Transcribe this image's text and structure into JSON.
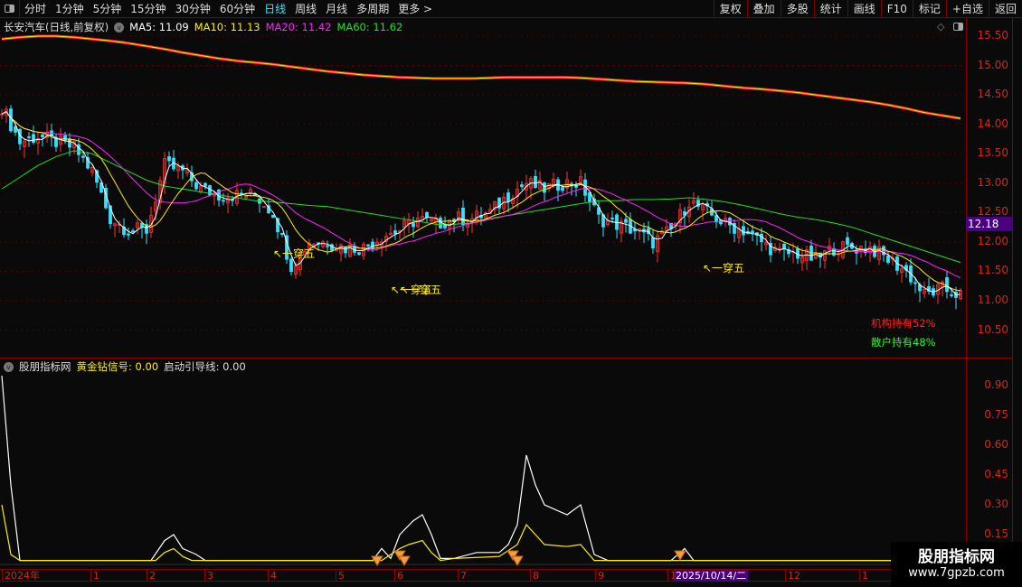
{
  "toolbar": {
    "periods": [
      "分时",
      "1分钟",
      "5分钟",
      "15分钟",
      "30分钟",
      "60分钟",
      "日线",
      "周线",
      "月线",
      "多周期",
      "更多 >"
    ],
    "active_period": "日线",
    "buttons": [
      "复权",
      "叠加",
      "多股",
      "统计",
      "画线",
      "F10",
      "标记",
      "+自选",
      "返回"
    ]
  },
  "main_legend": {
    "title": "长安汽车(日线,前复权)",
    "ma5": "MA5: 11.09",
    "ma10": "MA10: 11.13",
    "ma20": "MA20: 11.42",
    "ma60": "MA60: 11.62"
  },
  "price_axis": [
    "15.50",
    "15.00",
    "14.50",
    "14.00",
    "13.50",
    "13.00",
    "12.50",
    "12.00",
    "11.50",
    "11.00",
    "10.50"
  ],
  "current_price": "12.18",
  "annotation_label": "↖一穿五",
  "holdings": {
    "institution": "机构持有52%",
    "retail": "散户持有48%"
  },
  "sub_legend": {
    "title": "股朋指标网",
    "signal": "黄金钻信号: 0.00",
    "guide": "启动引导线: 0.00"
  },
  "sub_axis": [
    "0.90",
    "0.75",
    "0.60",
    "0.45",
    "0.30",
    "0.15"
  ],
  "x_axis": {
    "months": [
      "2024年",
      "1",
      "2",
      "3",
      "4",
      "5",
      "6",
      "7",
      "8",
      "9",
      "1",
      "12",
      "1"
    ],
    "cursor_date": "2025/10/14/二"
  },
  "watermark": {
    "name": "股朋指标网",
    "url": "www.7gpzb.com"
  },
  "colors": {
    "up": "#ff3030",
    "down": "#33e0ff",
    "ma5": "#ffffff",
    "ma10": "#ffee00",
    "ma20": "#ff20ff",
    "ma60": "#20e020",
    "accent": "#4a0080"
  },
  "chart_data": {
    "type": "candlestick",
    "price_range": [
      10.3,
      15.7
    ],
    "close_every_4_bars": [
      14.3,
      13.7,
      13.8,
      13.7,
      13.6,
      13.2,
      12.4,
      12.2,
      12.2,
      13.3,
      13.2,
      12.9,
      12.8,
      12.8,
      12.8,
      12.5,
      11.6,
      12.0,
      12.0,
      11.9,
      11.9,
      12.1,
      12.2,
      12.4,
      12.3,
      12.4,
      12.4,
      12.5,
      12.8,
      13.0,
      12.9,
      13.0,
      13.0,
      12.4,
      12.3,
      12.2,
      12.0,
      12.2,
      12.7,
      12.5,
      12.3,
      12.2,
      12.0,
      11.8,
      11.8,
      11.7,
      11.9,
      11.9,
      11.9,
      11.7,
      11.5,
      11.1,
      11.2,
      11.1
    ],
    "ma60_every_4_bars": [
      12.9,
      13.1,
      13.3,
      13.45,
      13.55,
      13.5,
      13.35,
      13.2,
      13.05,
      12.95,
      12.9,
      12.85,
      12.8,
      12.75,
      12.7,
      12.68,
      12.65,
      12.62,
      12.6,
      12.55,
      12.5,
      12.45,
      12.4,
      12.35,
      12.3,
      12.3,
      12.32,
      12.4,
      12.45,
      12.5,
      12.55,
      12.6,
      12.65,
      12.7,
      12.7,
      12.72,
      12.72,
      12.73,
      12.75,
      12.72,
      12.68,
      12.62,
      12.55,
      12.48,
      12.42,
      12.38,
      12.32,
      12.25,
      12.15,
      12.05,
      11.95,
      11.85,
      11.75,
      11.65
    ],
    "long_ma_every_4_bars": [
      15.45,
      15.48,
      15.5,
      15.5,
      15.48,
      15.45,
      15.42,
      15.38,
      15.33,
      15.28,
      15.22,
      15.17,
      15.12,
      15.08,
      15.05,
      15.02,
      14.98,
      14.94,
      14.9,
      14.87,
      14.84,
      14.82,
      14.8,
      14.79,
      14.78,
      14.78,
      14.78,
      14.79,
      14.8,
      14.8,
      14.8,
      14.8,
      14.79,
      14.77,
      14.75,
      14.73,
      14.72,
      14.71,
      14.7,
      14.68,
      14.65,
      14.62,
      14.6,
      14.57,
      14.54,
      14.5,
      14.46,
      14.42,
      14.38,
      14.33,
      14.27,
      14.2,
      14.15,
      14.1
    ],
    "annotations_bar": [
      61,
      87,
      89,
      156
    ],
    "indicator": {
      "name": "股朋指标网",
      "y_range": [
        0,
        1.0
      ],
      "white": [
        [
          0,
          0.95
        ],
        [
          2,
          0.4
        ],
        [
          4,
          0.02
        ],
        [
          33,
          0.02
        ],
        [
          36,
          0.12
        ],
        [
          38,
          0.15
        ],
        [
          40,
          0.08
        ],
        [
          43,
          0.05
        ],
        [
          45,
          0.02
        ],
        [
          82,
          0.02
        ],
        [
          84,
          0.08
        ],
        [
          86,
          0.03
        ],
        [
          88,
          0.15
        ],
        [
          91,
          0.22
        ],
        [
          93,
          0.25
        ],
        [
          95,
          0.15
        ],
        [
          97,
          0.03
        ],
        [
          100,
          0.03
        ],
        [
          105,
          0.06
        ],
        [
          110,
          0.06
        ],
        [
          112,
          0.1
        ],
        [
          114,
          0.2
        ],
        [
          116,
          0.55
        ],
        [
          118,
          0.4
        ],
        [
          120,
          0.3
        ],
        [
          125,
          0.25
        ],
        [
          128,
          0.3
        ],
        [
          131,
          0.05
        ],
        [
          134,
          0.02
        ],
        [
          148,
          0.02
        ],
        [
          151,
          0.08
        ],
        [
          153,
          0.02
        ],
        [
          212,
          0.02
        ]
      ],
      "yellow": [
        [
          0,
          0.3
        ],
        [
          2,
          0.05
        ],
        [
          4,
          0.02
        ],
        [
          34,
          0.02
        ],
        [
          36,
          0.06
        ],
        [
          38,
          0.08
        ],
        [
          40,
          0.04
        ],
        [
          42,
          0.02
        ],
        [
          84,
          0.02
        ],
        [
          88,
          0.08
        ],
        [
          90,
          0.1
        ],
        [
          93,
          0.12
        ],
        [
          95,
          0.06
        ],
        [
          97,
          0.02
        ],
        [
          100,
          0.03
        ],
        [
          110,
          0.04
        ],
        [
          114,
          0.1
        ],
        [
          116,
          0.2
        ],
        [
          118,
          0.15
        ],
        [
          120,
          0.1
        ],
        [
          125,
          0.09
        ],
        [
          128,
          0.1
        ],
        [
          131,
          0.02
        ],
        [
          212,
          0.02
        ]
      ],
      "diamond_bars": [
        83,
        88,
        89,
        113,
        114,
        150
      ]
    }
  }
}
